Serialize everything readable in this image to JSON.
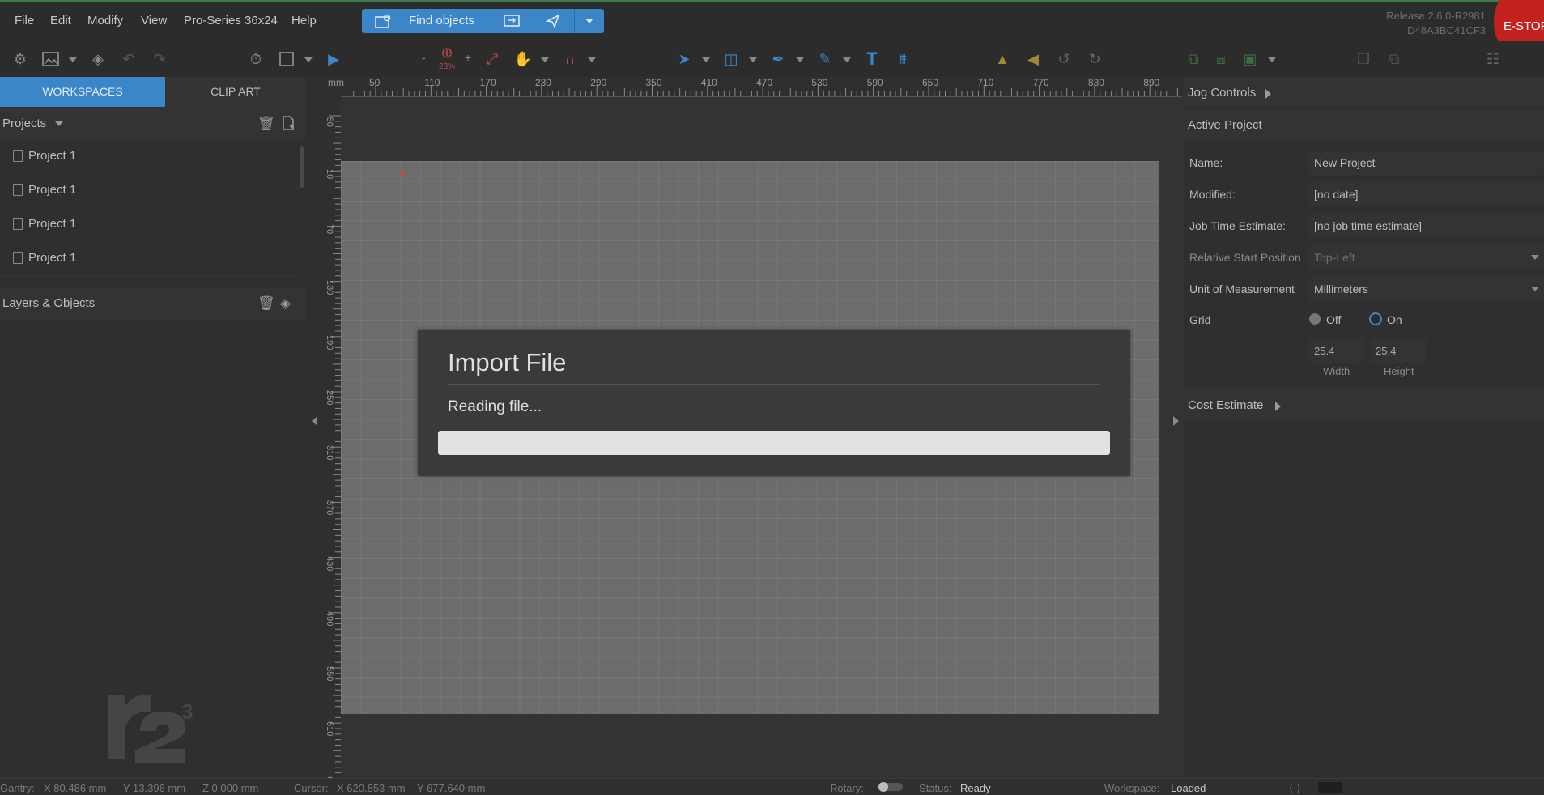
{
  "colors": {
    "accent": "#3a86c8",
    "estop": "#c4221f",
    "canvas": "#6c6c6c"
  },
  "menu": {
    "items": [
      "File",
      "Edit",
      "Modify",
      "View",
      "Pro-Series 36x24",
      "Help"
    ],
    "find_label": "Find objects"
  },
  "release": {
    "line1": "Release 2.6.0-R2981",
    "line2": "D48A3BC41CF3"
  },
  "estop_label": "E-STOP",
  "toolbar": {
    "zoom_minus": "-",
    "zoom_plus": "+",
    "zoom_percent": "23%"
  },
  "left": {
    "tabs": {
      "workspaces": "WORKSPACES",
      "clipart": "CLIP ART"
    },
    "projects_header": "Projects",
    "projects": [
      "Project 1",
      "Project 1",
      "Project 1",
      "Project 1"
    ],
    "layers_header": "Layers & Objects"
  },
  "ruler": {
    "unit": "mm",
    "top": [
      "50",
      "110",
      "170",
      "230",
      "290",
      "350",
      "410",
      "470",
      "530",
      "590",
      "650",
      "710",
      "770",
      "830",
      "890"
    ],
    "left": [
      "-50",
      "10",
      "70",
      "130",
      "190",
      "250",
      "310",
      "370",
      "430",
      "490",
      "550",
      "610",
      "670"
    ]
  },
  "modal": {
    "title": "Import File",
    "message": "Reading file...",
    "progress": 0
  },
  "right": {
    "jog": "Jog Controls",
    "active_project": "Active Project",
    "fields": {
      "name_label": "Name:",
      "name_value": "New Project",
      "modified_label": "Modified:",
      "modified_value": "[no date]",
      "job_label": "Job Time Estimate:",
      "job_value": "[no job time estimate]",
      "start_label": "Relative Start Position",
      "start_value": "Top-Left",
      "unit_label": "Unit of Measurement",
      "unit_value": "Millimeters",
      "grid_label": "Grid",
      "grid_off": "Off",
      "grid_on": "On",
      "grid_width": "25.4",
      "grid_height": "25.4",
      "width_label": "Width",
      "height_label": "Height"
    },
    "cost": "Cost Estimate"
  },
  "status": {
    "gantry_label": "Gantry:",
    "gantry_x": "X 80.486 mm",
    "gantry_y": "Y 13.396 mm",
    "gantry_z": "Z 0.000 mm",
    "cursor_label": "Cursor:",
    "cursor_x": "X 620.853 mm",
    "cursor_y": "Y 677.640 mm",
    "rotary_label": "Rotary:",
    "status_label": "Status:",
    "status_value": "Ready",
    "workspace_label": "Workspace:",
    "workspace_value": "Loaded"
  }
}
